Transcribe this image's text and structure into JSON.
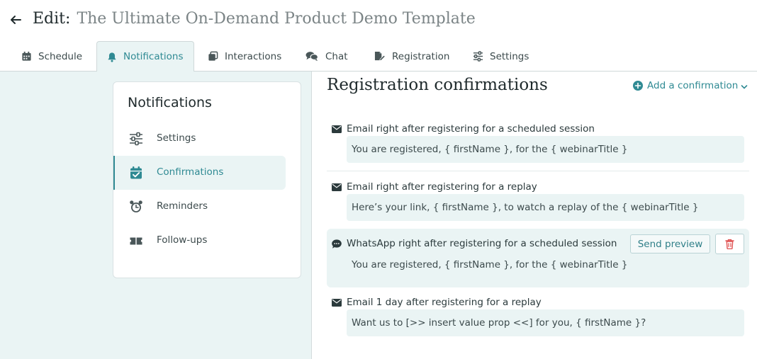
{
  "header": {
    "back_icon": "arrow-left-icon",
    "title_prefix": "Edit:",
    "title_name": "The Ultimate On-Demand Product Demo Template"
  },
  "tabs": [
    {
      "label": "Schedule",
      "icon": "calendar-icon"
    },
    {
      "label": "Notifications",
      "icon": "bell-icon",
      "active": true
    },
    {
      "label": "Interactions",
      "icon": "cards-icon"
    },
    {
      "label": "Chat",
      "icon": "chat-icon"
    },
    {
      "label": "Registration",
      "icon": "edit-form-icon"
    },
    {
      "label": "Settings",
      "icon": "sliders-icon"
    }
  ],
  "sidebar": {
    "title": "Notifications",
    "items": [
      {
        "label": "Settings",
        "icon": "sliders-icon"
      },
      {
        "label": "Confirmations",
        "icon": "calendar-check-icon",
        "active": true
      },
      {
        "label": "Reminders",
        "icon": "alarm-clock-icon"
      },
      {
        "label": "Follow-ups",
        "icon": "ticket-icon"
      }
    ]
  },
  "main": {
    "title": "Registration confirmations",
    "add_label": "Add a confirmation",
    "confirmations": [
      {
        "channel_icon": "envelope-icon",
        "heading": "Email right after registering for a scheduled session",
        "message": "You are registered, { firstName }, for the { webinarTitle }"
      },
      {
        "channel_icon": "envelope-icon",
        "heading": "Email right after registering for a replay",
        "message": "Here’s your link, { firstName }, to watch a replay of the { webinarTitle }"
      },
      {
        "channel_icon": "sms-bubble-icon",
        "heading": "WhatsApp right after registering for a scheduled session",
        "message": "You are registered, { firstName }, for the { webinarTitle }",
        "preview_label": "Send preview"
      },
      {
        "channel_icon": "envelope-icon",
        "heading": "Email 1 day after registering for a replay",
        "message": "Want us to [>> insert value prop <<] for you, { firstName }?"
      }
    ]
  },
  "colors": {
    "accent": "#2f8a93",
    "panel_bg": "#eaf4f4",
    "danger": "#e05252"
  }
}
